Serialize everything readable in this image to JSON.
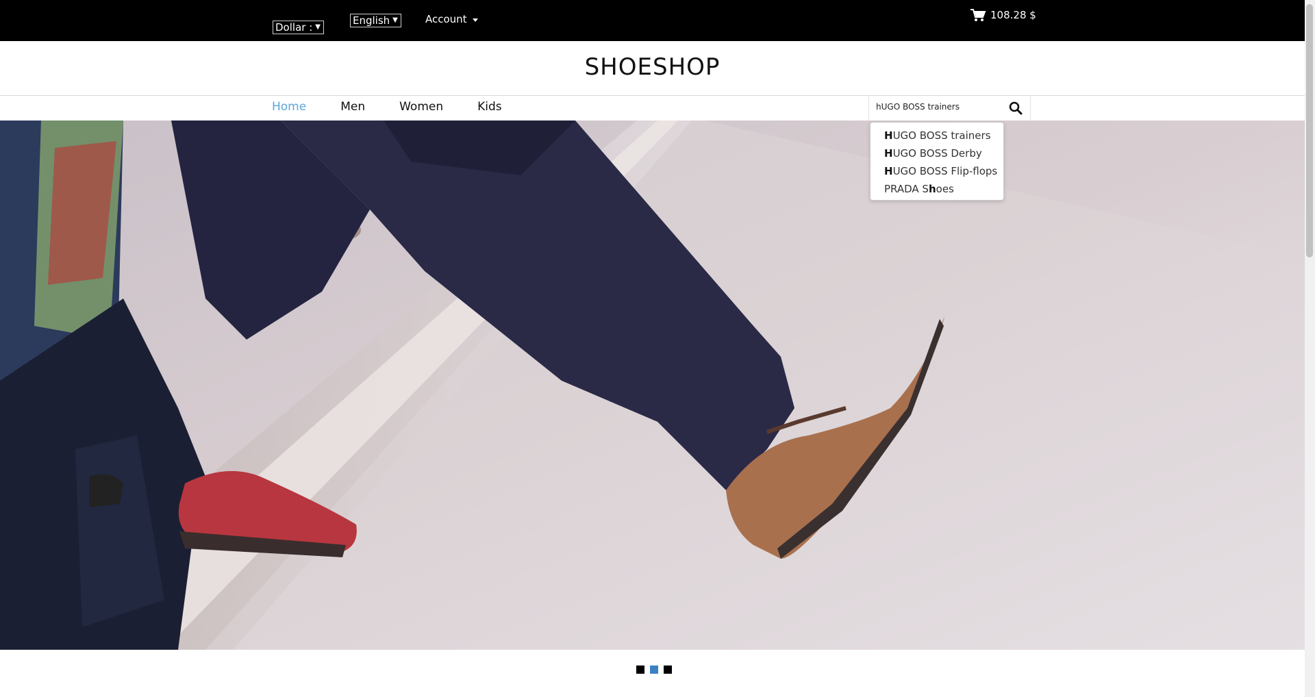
{
  "topbar": {
    "currency": "Dollar :",
    "language": "English",
    "account_label": "Account",
    "cart_total": "108.28 $"
  },
  "header": {
    "brand": "SHOESHOP"
  },
  "nav": {
    "items": [
      {
        "label": "Home",
        "active": true
      },
      {
        "label": "Men"
      },
      {
        "label": "Women"
      },
      {
        "label": "Kids"
      }
    ]
  },
  "search": {
    "value": "hUGO BOSS trainers",
    "suggestions": [
      {
        "bold": "H",
        "rest": "UGO BOSS trainers"
      },
      {
        "bold": "H",
        "rest": "UGO BOSS Derby"
      },
      {
        "bold": "H",
        "rest": "UGO BOSS Flip-flops"
      },
      {
        "pre": "PRADA S",
        "bold": "h",
        "rest": "oes"
      }
    ]
  },
  "carousel": {
    "slide_count": 3,
    "active_index": 1
  },
  "colors": {
    "topbar": "#000000",
    "accent": "#5ca6d8",
    "dot_active": "#3b82c4"
  }
}
